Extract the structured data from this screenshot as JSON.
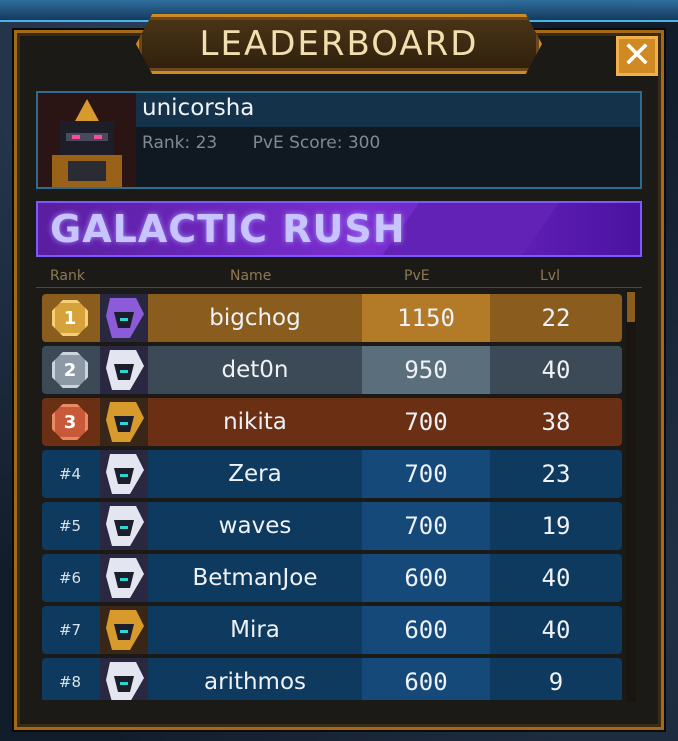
{
  "header": {
    "title": "LEADERBOARD",
    "close_icon": "close-x-icon"
  },
  "player": {
    "name": "unicorsha",
    "rank_text": "Rank: 23",
    "pve_text": "PvE Score: 300",
    "avatar_icon": "helmet-avatar-icon"
  },
  "event": {
    "title": "GALACTIC RUSH"
  },
  "columns": {
    "rank": "Rank",
    "name": "Name",
    "pve": "PvE",
    "lvl": "Lvl"
  },
  "rows": [
    {
      "rank": "1",
      "name": "bigchog",
      "pve": "1150",
      "lvl": "22",
      "medal": "gold",
      "colors": {
        "bg": "#8a5d1f",
        "pve_bg": "#b37a27"
      },
      "avatar": "purple"
    },
    {
      "rank": "2",
      "name": "det0n",
      "pve": "950",
      "lvl": "40",
      "medal": "silver",
      "colors": {
        "bg": "#3b4a56",
        "pve_bg": "#5b6e7c"
      },
      "avatar": "white"
    },
    {
      "rank": "3",
      "name": "nikita",
      "pve": "700",
      "lvl": "38",
      "medal": "bronze",
      "colors": {
        "bg": "#6b2f14",
        "pve_bg": "#6b2f14"
      },
      "avatar": "gold"
    },
    {
      "rank": "#4",
      "name": "Zera",
      "pve": "700",
      "lvl": "23",
      "colors": {
        "bg": "#0f3a5f",
        "pve_bg": "#15497a"
      },
      "avatar": "white"
    },
    {
      "rank": "#5",
      "name": "waves",
      "pve": "700",
      "lvl": "19",
      "colors": {
        "bg": "#0f3a5f",
        "pve_bg": "#15497a"
      },
      "avatar": "white"
    },
    {
      "rank": "#6",
      "name": "BetmanJoe",
      "pve": "600",
      "lvl": "40",
      "colors": {
        "bg": "#0f3a5f",
        "pve_bg": "#15497a"
      },
      "avatar": "white"
    },
    {
      "rank": "#7",
      "name": "Mira",
      "pve": "600",
      "lvl": "40",
      "colors": {
        "bg": "#0f3a5f",
        "pve_bg": "#15497a"
      },
      "avatar": "gold"
    },
    {
      "rank": "#8",
      "name": "arithmos",
      "pve": "600",
      "lvl": "9",
      "colors": {
        "bg": "#0f3a5f",
        "pve_bg": "#15497a"
      },
      "avatar": "white"
    }
  ],
  "medal_colors": {
    "gold": {
      "fill": "#d6a23c",
      "rim": "#f4cf78"
    },
    "silver": {
      "fill": "#8d9aa6",
      "rim": "#c9d4dc"
    },
    "bronze": {
      "fill": "#c85a3a",
      "rim": "#e98a66"
    }
  }
}
